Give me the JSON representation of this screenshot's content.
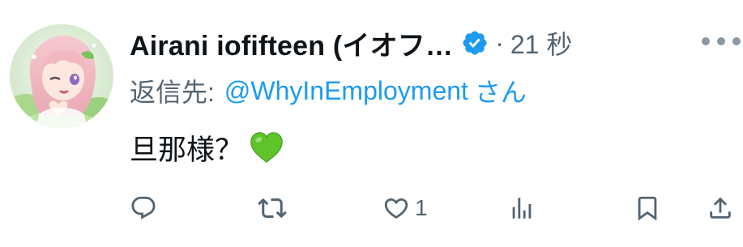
{
  "author": {
    "display_name": "Airani iofifteen (イオフ…",
    "verified": true,
    "separator": "·",
    "timestamp": "21 秒"
  },
  "reply": {
    "prefix": "返信先:",
    "handle": "@WhyInEmployment",
    "suffix": "さん"
  },
  "tweet": {
    "text": "旦那様？",
    "emoji": "green-heart"
  },
  "actions": {
    "reply_count": "",
    "retweet_count": "",
    "like_count": "1",
    "view_count": ""
  },
  "colors": {
    "text_primary": "#0f1419",
    "text_secondary": "#536471",
    "link": "#1d9bf0",
    "verified_badge": "#1d9bf0",
    "heart_emoji": "#5fc42a"
  }
}
